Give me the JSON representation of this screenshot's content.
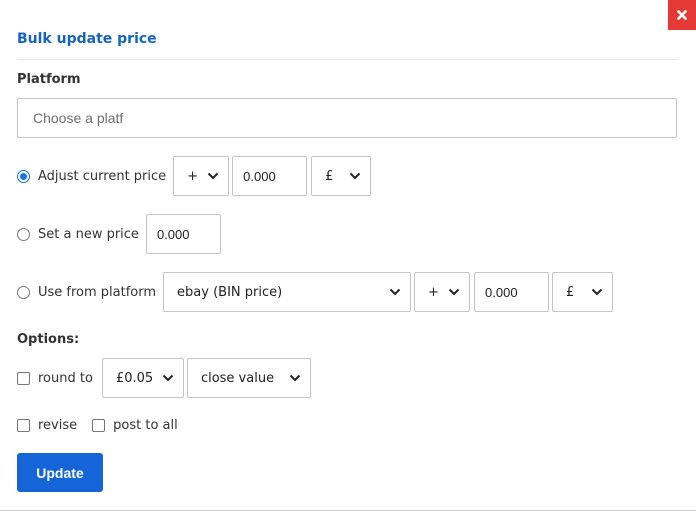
{
  "dialog": {
    "title": "Bulk update price",
    "close_icon": "close-icon"
  },
  "platform": {
    "label": "Platform",
    "placeholder": "Choose a platf",
    "value": ""
  },
  "adjust": {
    "label": "Adjust current price",
    "checked": true,
    "operator": "+",
    "amount": "0.000",
    "currency": "£"
  },
  "set_new": {
    "label": "Set a new price",
    "checked": false,
    "amount": "0.000"
  },
  "from_platform": {
    "label": "Use from platform",
    "checked": false,
    "source": "ebay (BIN price)",
    "operator": "+",
    "amount": "0.000",
    "currency": "£"
  },
  "options": {
    "label": "Options:",
    "round_to": {
      "label": "round to",
      "checked": false,
      "amount": "£0.05",
      "mode": "close value"
    },
    "revise": {
      "label": "revise",
      "checked": false
    },
    "post_to_all": {
      "label": "post to all",
      "checked": false
    }
  },
  "actions": {
    "update_label": "Update"
  },
  "colors": {
    "accent": "#1565d8",
    "title": "#1565c0",
    "close": "#e53935"
  }
}
